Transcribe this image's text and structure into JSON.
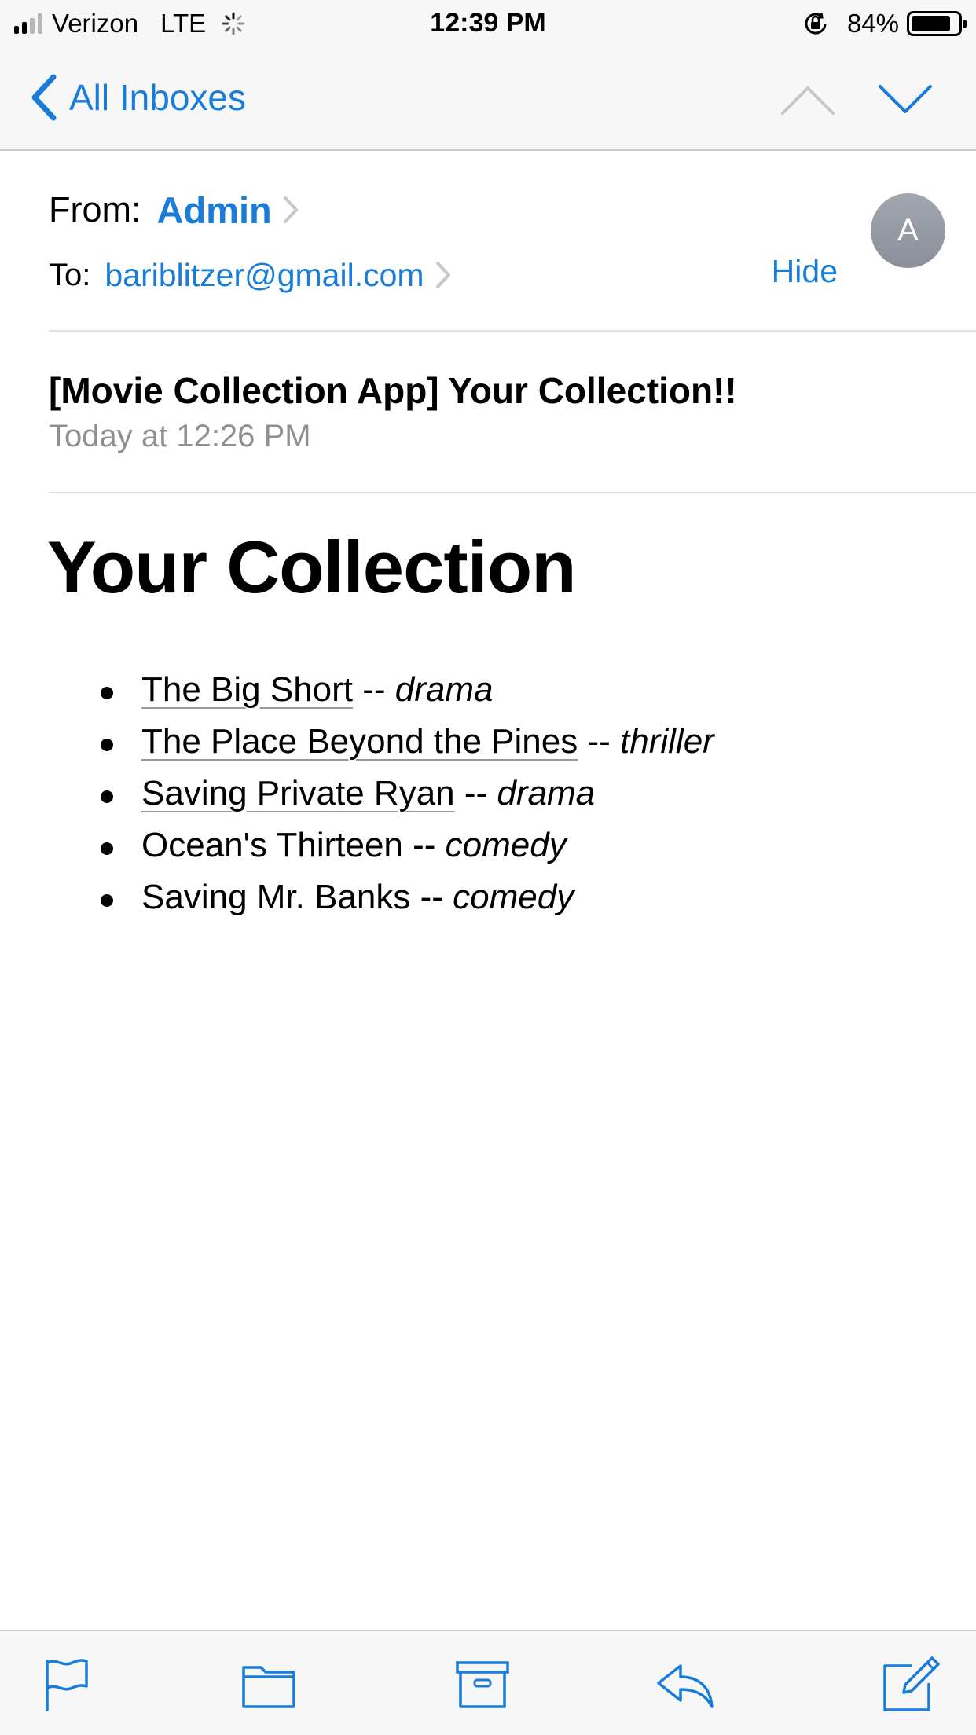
{
  "status_bar": {
    "carrier": "Verizon",
    "network": "LTE",
    "time": "12:39 PM",
    "battery_percent_label": "84%",
    "battery_level": 0.84,
    "signal_bars": 2,
    "icons": [
      "signal-bars-icon",
      "activity-spinner-icon",
      "orientation-lock-icon",
      "battery-icon"
    ]
  },
  "nav": {
    "back_label": "All Inboxes",
    "icons": [
      "chevron-left-icon",
      "chevron-up-icon",
      "chevron-down-icon"
    ]
  },
  "header": {
    "from_label": "From:",
    "from_name": "Admin",
    "to_label": "To:",
    "to_address": "bariblitzer@gmail.com",
    "hide_label": "Hide",
    "avatar_initial": "A",
    "subject": "[Movie Collection App] Your Collection!!",
    "date": "Today at 12:26 PM"
  },
  "body": {
    "heading": "Your Collection",
    "separator": " -- ",
    "movies": [
      {
        "title": "The Big Short",
        "genre": "drama",
        "linked": true
      },
      {
        "title": "The Place Beyond the Pines",
        "genre": "thriller",
        "linked": true
      },
      {
        "title": "Saving Private Ryan",
        "genre": "drama",
        "linked": true
      },
      {
        "title": "Ocean's Thirteen",
        "genre": "comedy",
        "linked": false
      },
      {
        "title": "Saving Mr. Banks",
        "genre": "comedy",
        "linked": false
      }
    ]
  },
  "toolbar": {
    "icons": [
      "flag-icon",
      "folder-icon",
      "archive-icon",
      "reply-icon",
      "compose-icon"
    ]
  },
  "colors": {
    "accent": "#1a7cd9",
    "secondary_text": "#8e8e93",
    "bar_background": "#f7f7f7",
    "avatar": "#959aa3"
  }
}
